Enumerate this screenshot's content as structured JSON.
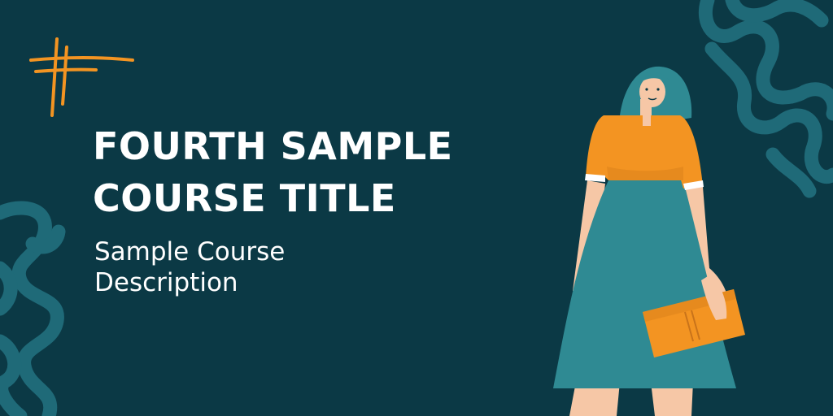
{
  "banner": {
    "title_line1": "FOURTH SAMPLE",
    "title_line2": "COURSE TITLE",
    "description_line1": "Sample Course",
    "description_line2": "Description"
  },
  "colors": {
    "background": "#0b3945",
    "squiggle": "#1f6a78",
    "accent_orange": "#f39422",
    "skirt_teal": "#2f8a93",
    "skin": "#f6c7a6",
    "text": "#ffffff"
  },
  "illustration": {
    "subject": "woman-holding-clutch-illustration",
    "decorations": [
      "squiggle-pattern",
      "hashtag-doodle-icon"
    ]
  }
}
